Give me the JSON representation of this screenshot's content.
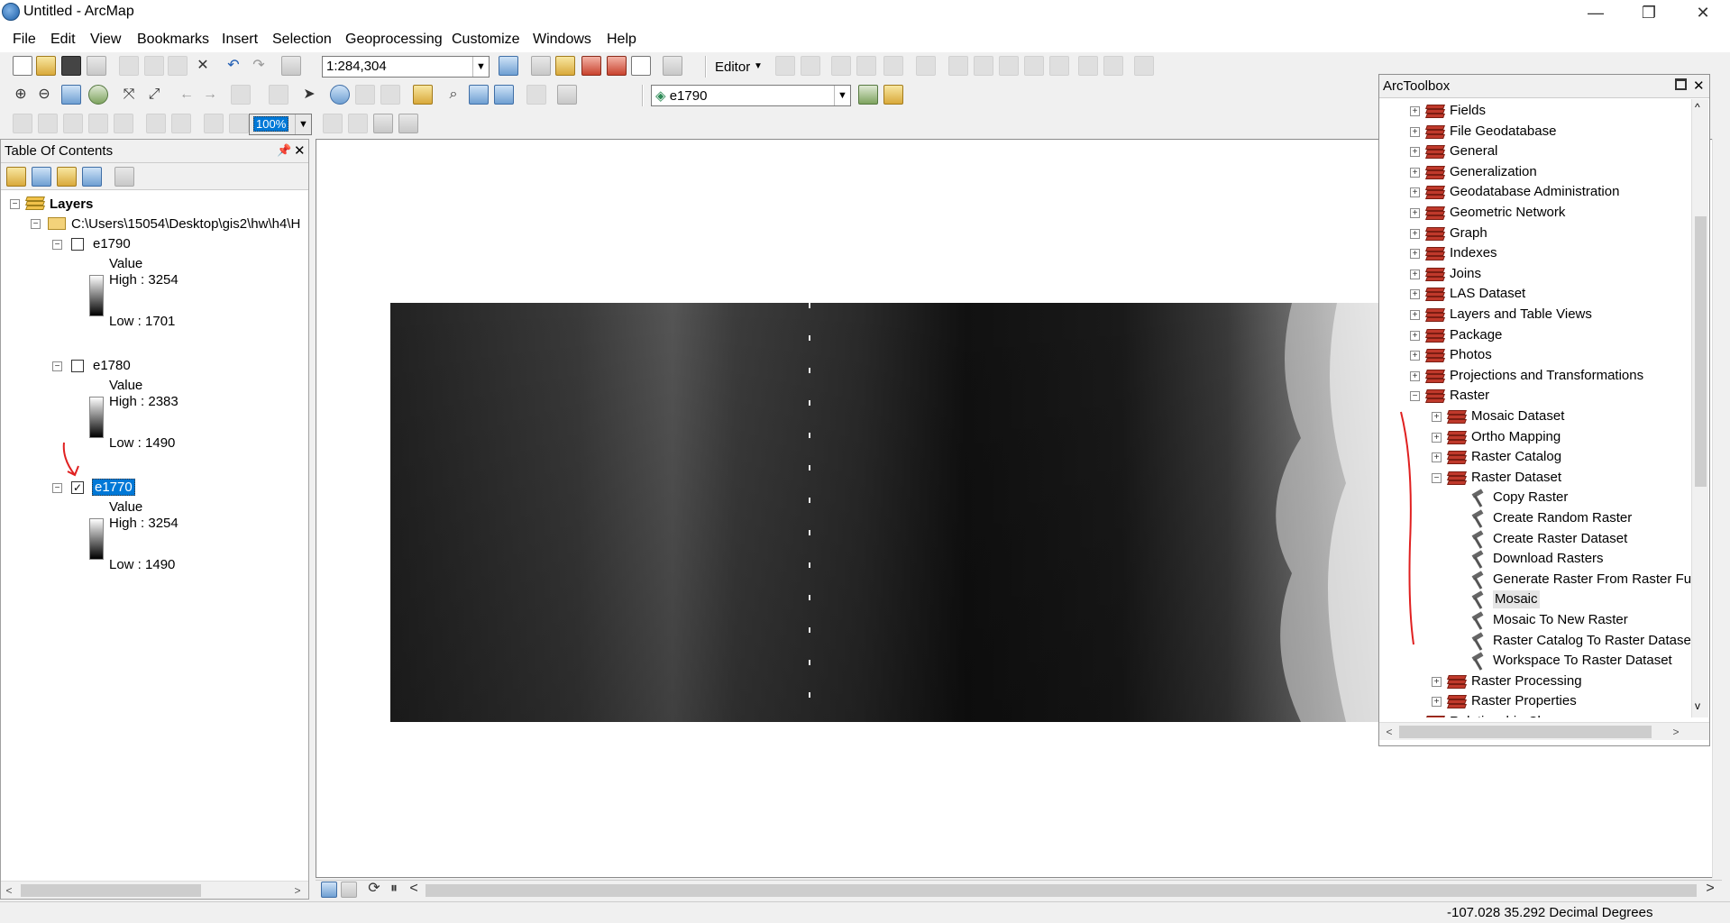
{
  "window": {
    "title": "Untitled - ArcMap",
    "minimize": "—",
    "maximize": "❐",
    "close": "✕"
  },
  "menu": [
    "File",
    "Edit",
    "View",
    "Bookmarks",
    "Insert",
    "Selection",
    "Geoprocessing",
    "Customize",
    "Windows",
    "Help"
  ],
  "toolbar": {
    "scale": "1:284,304",
    "editor_label": "Editor",
    "layer_combo": "e1790",
    "zoom_box": "100%"
  },
  "toc": {
    "title": "Table Of Contents",
    "layers_label": "Layers",
    "path": "C:\\Users\\15054\\Desktop\\gis2\\hw\\h4\\H",
    "layers": [
      {
        "name": "e1790",
        "checked": false,
        "value_label": "Value",
        "high": "High : 3254",
        "low": "Low : 1701"
      },
      {
        "name": "e1780",
        "checked": false,
        "value_label": "Value",
        "high": "High : 2383",
        "low": "Low : 1490"
      },
      {
        "name": "e1770",
        "checked": true,
        "value_label": "Value",
        "high": "High : 3254",
        "low": "Low : 1490"
      }
    ]
  },
  "arctoolbox": {
    "title": "ArcToolbox",
    "items": [
      {
        "label": "Fields",
        "level": 0,
        "kind": "box",
        "expanded": false
      },
      {
        "label": "File Geodatabase",
        "level": 0,
        "kind": "box",
        "expanded": false
      },
      {
        "label": "General",
        "level": 0,
        "kind": "box",
        "expanded": false
      },
      {
        "label": "Generalization",
        "level": 0,
        "kind": "box",
        "expanded": false
      },
      {
        "label": "Geodatabase Administration",
        "level": 0,
        "kind": "box",
        "expanded": false
      },
      {
        "label": "Geometric Network",
        "level": 0,
        "kind": "box",
        "expanded": false
      },
      {
        "label": "Graph",
        "level": 0,
        "kind": "box",
        "expanded": false
      },
      {
        "label": "Indexes",
        "level": 0,
        "kind": "box",
        "expanded": false
      },
      {
        "label": "Joins",
        "level": 0,
        "kind": "box",
        "expanded": false
      },
      {
        "label": "LAS Dataset",
        "level": 0,
        "kind": "box",
        "expanded": false
      },
      {
        "label": "Layers and Table Views",
        "level": 0,
        "kind": "box",
        "expanded": false
      },
      {
        "label": "Package",
        "level": 0,
        "kind": "box",
        "expanded": false
      },
      {
        "label": "Photos",
        "level": 0,
        "kind": "box",
        "expanded": false
      },
      {
        "label": "Projections and Transformations",
        "level": 0,
        "kind": "box",
        "expanded": false
      },
      {
        "label": "Raster",
        "level": 0,
        "kind": "box",
        "expanded": true
      },
      {
        "label": "Mosaic Dataset",
        "level": 1,
        "kind": "box",
        "expanded": false
      },
      {
        "label": "Ortho Mapping",
        "level": 1,
        "kind": "box",
        "expanded": false
      },
      {
        "label": "Raster Catalog",
        "level": 1,
        "kind": "box",
        "expanded": false
      },
      {
        "label": "Raster Dataset",
        "level": 1,
        "kind": "box",
        "expanded": true
      },
      {
        "label": "Copy Raster",
        "level": 2,
        "kind": "tool"
      },
      {
        "label": "Create Random Raster",
        "level": 2,
        "kind": "tool"
      },
      {
        "label": "Create Raster Dataset",
        "level": 2,
        "kind": "tool"
      },
      {
        "label": "Download Rasters",
        "level": 2,
        "kind": "tool"
      },
      {
        "label": "Generate Raster From Raster Fun",
        "level": 2,
        "kind": "tool"
      },
      {
        "label": "Mosaic",
        "level": 2,
        "kind": "tool",
        "selected": true
      },
      {
        "label": "Mosaic To New Raster",
        "level": 2,
        "kind": "tool"
      },
      {
        "label": "Raster Catalog To Raster Dataset",
        "level": 2,
        "kind": "tool"
      },
      {
        "label": "Workspace To Raster Dataset",
        "level": 2,
        "kind": "tool"
      },
      {
        "label": "Raster Processing",
        "level": 1,
        "kind": "box",
        "expanded": false
      },
      {
        "label": "Raster Properties",
        "level": 1,
        "kind": "box",
        "expanded": false
      },
      {
        "label": "Relationship Classes",
        "level": 0,
        "kind": "box",
        "expanded": false
      }
    ]
  },
  "status": {
    "coordinates": "-107.028  35.292 Decimal Degrees"
  },
  "colors": {
    "selection": "#0078d7",
    "annotation": "#e02020"
  }
}
